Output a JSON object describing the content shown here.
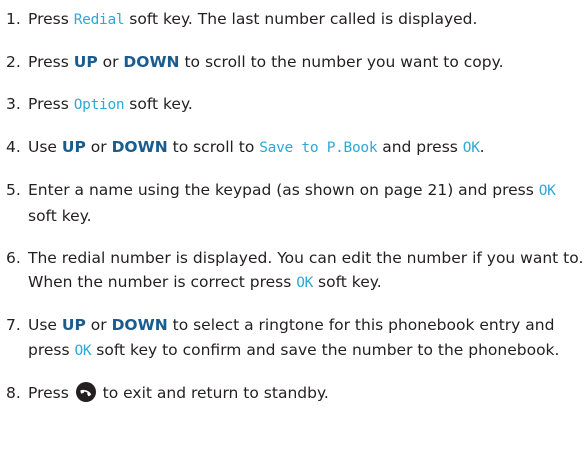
{
  "steps": [
    {
      "num": "1.",
      "parts": [
        {
          "t": "text",
          "v": "Press "
        },
        {
          "t": "lcd",
          "v": "Redial"
        },
        {
          "t": "text",
          "v": " soft key. The last number called is displayed."
        }
      ]
    },
    {
      "num": "2.",
      "parts": [
        {
          "t": "text",
          "v": "Press "
        },
        {
          "t": "kw",
          "v": "UP"
        },
        {
          "t": "text",
          "v": " or "
        },
        {
          "t": "kw",
          "v": "DOWN"
        },
        {
          "t": "text",
          "v": " to scroll to the number you want to copy."
        }
      ]
    },
    {
      "num": "3.",
      "parts": [
        {
          "t": "text",
          "v": "Press "
        },
        {
          "t": "lcd",
          "v": "Option"
        },
        {
          "t": "text",
          "v": " soft key."
        }
      ]
    },
    {
      "num": "4.",
      "parts": [
        {
          "t": "text",
          "v": "Use "
        },
        {
          "t": "kw",
          "v": "UP"
        },
        {
          "t": "text",
          "v": " or "
        },
        {
          "t": "kw",
          "v": "DOWN"
        },
        {
          "t": "text",
          "v": " to scroll to "
        },
        {
          "t": "lcd",
          "v": "Save to P.Book"
        },
        {
          "t": "text",
          "v": " and press "
        },
        {
          "t": "lcd",
          "v": "OK"
        },
        {
          "t": "text",
          "v": "."
        }
      ]
    },
    {
      "num": "5.",
      "parts": [
        {
          "t": "text",
          "v": "Enter a name using the keypad (as shown on page 21) and press "
        },
        {
          "t": "lcd",
          "v": "OK"
        },
        {
          "t": "text",
          "v": " soft key."
        }
      ]
    },
    {
      "num": "6.",
      "parts": [
        {
          "t": "text",
          "v": "The redial number is displayed. You can edit the number if you want to. When the number is correct press "
        },
        {
          "t": "lcd",
          "v": "OK"
        },
        {
          "t": "text",
          "v": " soft key."
        }
      ]
    },
    {
      "num": "7.",
      "parts": [
        {
          "t": "text",
          "v": "Use "
        },
        {
          "t": "kw",
          "v": "UP"
        },
        {
          "t": "text",
          "v": " or "
        },
        {
          "t": "kw",
          "v": "DOWN"
        },
        {
          "t": "text",
          "v": " to select a ringtone for this phonebook entry and press "
        },
        {
          "t": "lcd",
          "v": "OK"
        },
        {
          "t": "text",
          "v": " soft key to confirm and save the number to the phonebook."
        }
      ]
    },
    {
      "num": "8.",
      "parts": [
        {
          "t": "text",
          "v": "Press "
        },
        {
          "t": "icon",
          "v": "end-call-icon"
        },
        {
          "t": "text",
          "v": " to exit and return to standby."
        }
      ]
    }
  ],
  "colors": {
    "text": "#231f20",
    "keyword": "#1a5c8e",
    "display_text": "#2fa8d6"
  }
}
